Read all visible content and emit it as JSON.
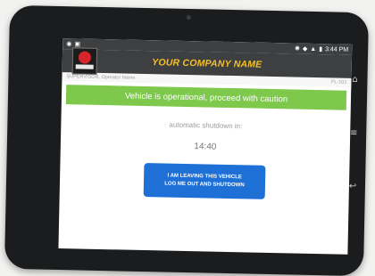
{
  "status_bar": {
    "left_icons": [
      "eye-icon",
      "notification-icon"
    ],
    "right_icons": [
      "bluetooth-icon",
      "location-icon",
      "signal-icon",
      "battery-icon"
    ],
    "time": "3:44 PM"
  },
  "header": {
    "company_name": "YOUR COMPANY NAME"
  },
  "subheader": {
    "operator": "SUPERVISOR, Operator Name",
    "unit_id": "FL-101"
  },
  "main": {
    "status_banner": "Vehicle is operational, proceed with caution",
    "shutdown_label": "automatic shutdown in:",
    "countdown": "14:40",
    "logout_button": {
      "line1": "I AM LEAVING THIS VEHICLE",
      "line2": "LOG ME OUT AND SHUTDOWN"
    }
  },
  "colors": {
    "app_bar": "#3e3f41",
    "company_name": "#f5c026",
    "banner": "#7ec84b",
    "button": "#1e6fd6"
  },
  "device_buttons": {
    "icons": [
      "home-icon",
      "menu-icon",
      "back-icon"
    ]
  }
}
